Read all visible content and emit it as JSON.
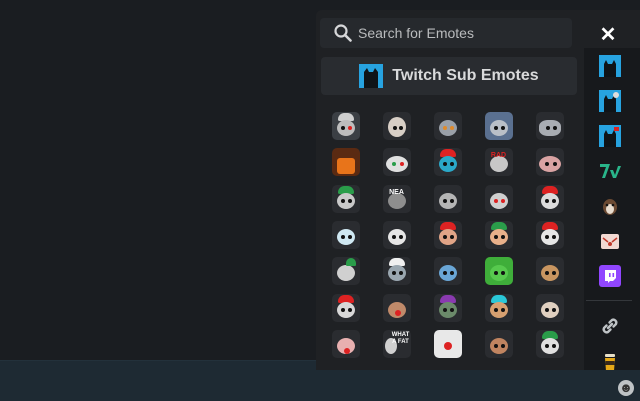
{
  "search": {
    "placeholder": "Search for Emotes"
  },
  "close_label": "✕",
  "section": {
    "title": "Twitch Sub Emotes"
  },
  "emote_texts": {
    "e9_label": "RAD",
    "e12_label": "NEA",
    "e31_label": "WHAT A FAT"
  },
  "sidebar": {
    "items": [
      {
        "name": "channel-emotes-1-icon"
      },
      {
        "name": "channel-emotes-2-icon"
      },
      {
        "name": "channel-emotes-3-icon"
      },
      {
        "name": "7tv-icon"
      },
      {
        "name": "dog-emotes-icon"
      },
      {
        "name": "cat-emotes-icon"
      },
      {
        "name": "twitch-icon"
      },
      {
        "name": "link-icon"
      },
      {
        "name": "cup-icon"
      }
    ]
  },
  "colors": {
    "accent": "#27a3e0",
    "twitch": "#9146ff",
    "seventv": "#29b58a"
  }
}
